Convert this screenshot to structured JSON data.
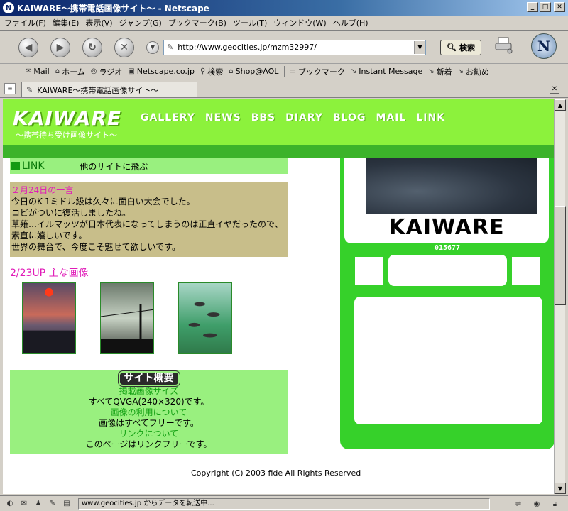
{
  "window": {
    "title": "KAIWARE～携帯電話画像サイト～ - Netscape",
    "app_icon": "N"
  },
  "menu": [
    "ファイル(F)",
    "編集(E)",
    "表示(V)",
    "ジャンプ(G)",
    "ブックマーク(B)",
    "ツール(T)",
    "ウィンドウ(W)",
    "ヘルプ(H)"
  ],
  "navbar": {
    "url": "http://www.geocities.jp/mzm32997/",
    "search_label": "検索"
  },
  "bookmarks": [
    {
      "icon": "mail-icon",
      "label": "Mail"
    },
    {
      "icon": "home-icon",
      "label": "ホーム"
    },
    {
      "icon": "radio-icon",
      "label": "ラジオ"
    },
    {
      "icon": "my-icon",
      "label": "Netscape.co.jp"
    },
    {
      "icon": "search-icon",
      "label": "検索"
    },
    {
      "icon": "shop-icon",
      "label": "Shop@AOL"
    },
    {
      "icon": "folder-icon",
      "label": "ブックマーク"
    },
    {
      "icon": "bookmark-icon",
      "label": "Instant Message"
    },
    {
      "icon": "bookmark-icon",
      "label": "新着"
    },
    {
      "icon": "bookmark-icon",
      "label": "お勧め"
    }
  ],
  "tab": {
    "label": "KAIWARE～携帯電話画像サイト～"
  },
  "site": {
    "logo": "KAIWARE",
    "logo_sub": "～携帯待ち受け画像サイト～",
    "nav": [
      "GALLERY",
      "NEWS",
      "BBS",
      "DIARY",
      "BLOG",
      "MAIL",
      "LINK"
    ],
    "link_box": {
      "link": "LINK",
      "text": "-----------他のサイトに飛ぶ"
    },
    "diary": {
      "date": "２月24日の一言",
      "lines": [
        "今日のK-1ミドル級は久々に面白い大会でした。",
        "コビがついに復活しましたね。",
        "草薙…イルマッツが日本代表になってしまうのは正直イヤだったので、",
        "素直に嬉しいです。",
        "世界の舞台で、今度こそ魅せて欲しいです。"
      ]
    },
    "images_heading": "2/23UP 主な画像",
    "info": {
      "heading": "サイト概要",
      "rows": [
        {
          "head": "掲載画像サイズ",
          "text": "すべてQVGA(240×320)です。"
        },
        {
          "head": "画像の利用について",
          "text": "画像はすべてフリーです。"
        },
        {
          "head": "リンクについて",
          "text": "このページはリンクフリーです。"
        }
      ]
    },
    "widget": {
      "title": "KAIWARE",
      "counter": "015677"
    },
    "copyright": "Copyright (C) 2003 fide All Rights Reserved"
  },
  "status": {
    "text": "www.geocities.jp からデータを転送中..."
  }
}
